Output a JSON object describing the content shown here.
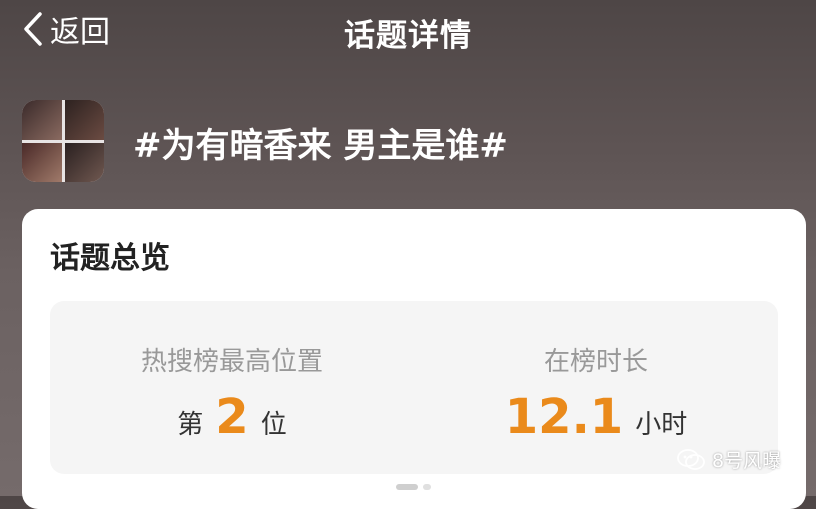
{
  "nav": {
    "back_label": "返回",
    "title": "话题详情"
  },
  "topic": {
    "title": "#为有暗香来 男主是谁#"
  },
  "overview": {
    "title": "话题总览",
    "highest_rank": {
      "label": "热搜榜最高位置",
      "prefix": "第",
      "value": "2",
      "suffix": "位"
    },
    "duration": {
      "label": "在榜时长",
      "value": "12.1",
      "suffix": "小时"
    }
  },
  "watermark": {
    "text": "8号风曝",
    "icon": "wechat-icon"
  },
  "colors": {
    "accent": "#ea8a1b",
    "card_bg": "#ffffff",
    "stats_bg": "#f5f5f5"
  }
}
